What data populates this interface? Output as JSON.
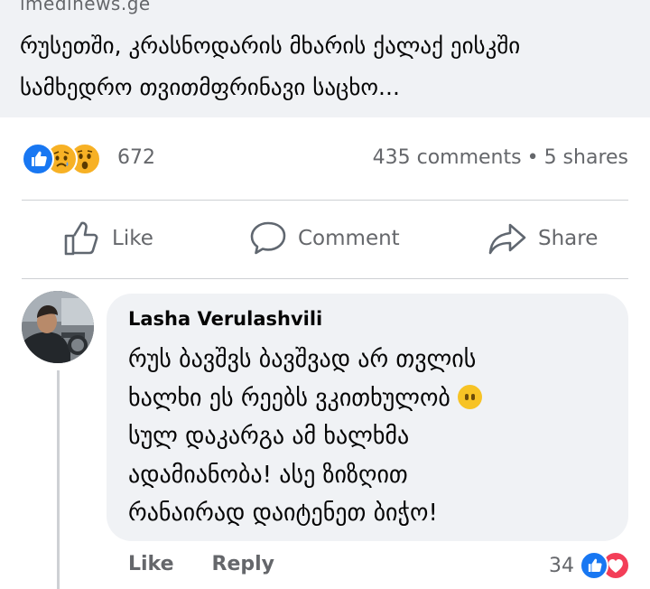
{
  "preview": {
    "domain": "imedinews.ge",
    "headline": "რუსეთში, კრასნოდარის მხარის ქალაქ ეისკში სამხედრო თვითმფრინავი საცხო..."
  },
  "stats": {
    "reaction_count": "672",
    "reaction_icons": [
      "like-icon",
      "sad-icon",
      "wow-icon"
    ],
    "comments": "435 comments",
    "separator": "•",
    "shares": "5 shares"
  },
  "actions": {
    "like": "Like",
    "comment": "Comment",
    "share": "Share"
  },
  "comment": {
    "author": "Lasha Verulashvili",
    "line1": "რუს ბავშვს ბავშვად არ თვლის",
    "line2": "ხალხი ეს რეებს ვკითხულობ",
    "line3": "სულ დაკარგა ამ ხალხმა",
    "line4": "ადამიანობა!  ასე ზიზღით",
    "line5": "რანაირად დაიტენეთ ბიჭო!",
    "like_label": "Like",
    "reply_label": "Reply",
    "reaction_count": "34",
    "reaction_icons": [
      "like-icon",
      "love-icon"
    ]
  },
  "colors": {
    "facebook_blue": "#1877f2",
    "love_red": "#f33e58",
    "emoji_yellow": "#f7b125",
    "muted_text": "#65676b",
    "bubble_bg": "#f0f2f5"
  }
}
